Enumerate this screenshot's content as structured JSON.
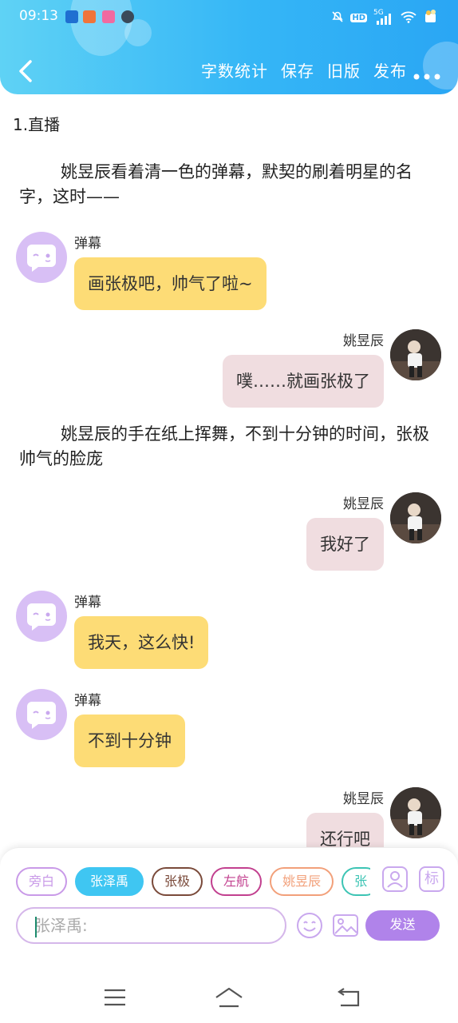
{
  "status_bar": {
    "time": "09:13",
    "hd": "HD",
    "signal": "5G"
  },
  "header": {
    "actions": [
      "字数统计",
      "保存",
      "旧版",
      "发布"
    ]
  },
  "content": {
    "section_title": "1.直播",
    "narration_1": "姚昱辰看着清一色的弹幕，默契的刷着明星的名字，这时——",
    "narration_2": "姚昱辰的手在纸上挥舞，不到十分钟的时间，张极帅气的脸庞",
    "messages": [
      {
        "speaker": "弹幕",
        "text": "画张极吧，帅气了啦~"
      },
      {
        "speaker": "姚昱辰",
        "text": "噗……就画张极了"
      },
      {
        "speaker": "姚昱辰",
        "text": "我好了"
      },
      {
        "speaker": "弹幕",
        "text": "我天，这么快!"
      },
      {
        "speaker": "弹幕",
        "text": "不到十分钟"
      },
      {
        "speaker": "姚昱辰",
        "text": "还行吧"
      }
    ]
  },
  "composer": {
    "chips": [
      {
        "label": "旁白",
        "color": "#c99ae8"
      },
      {
        "label": "张泽禹",
        "color": "#3fc6f2"
      },
      {
        "label": "张极",
        "color": "#7a4a3a"
      },
      {
        "label": "左航",
        "color": "#c2408f"
      },
      {
        "label": "姚昱辰",
        "color": "#f2a07a"
      },
      {
        "label": "张",
        "color": "#3cc4b4"
      }
    ],
    "input_placeholder": "张泽禹:",
    "send_label": "发送",
    "side_icon_text": "标"
  }
}
